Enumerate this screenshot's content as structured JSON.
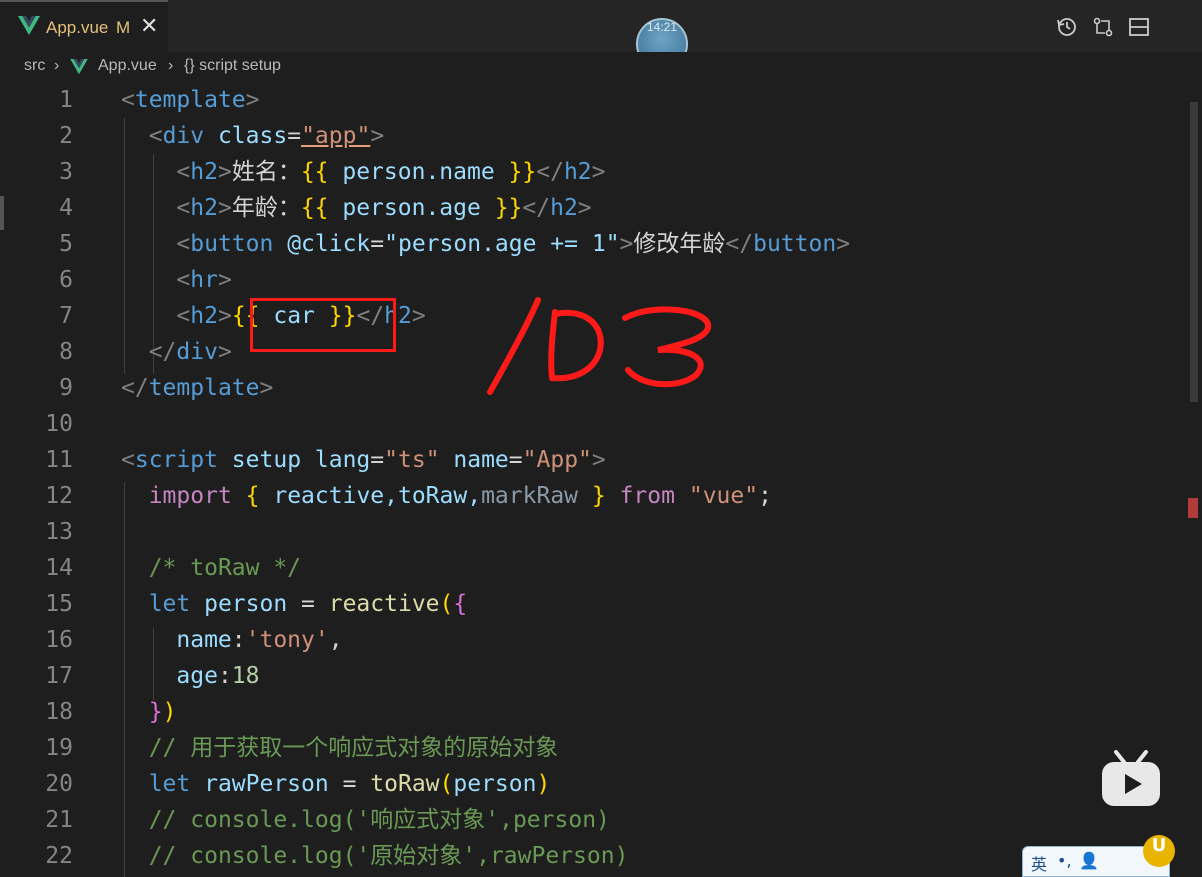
{
  "tab": {
    "label": "App.vue",
    "modified": "M",
    "close": "✕"
  },
  "clock": "14:21",
  "breadcrumb": {
    "root": "src",
    "file": "App.vue",
    "symbol": "{} script setup"
  },
  "lines": [
    {
      "n": "1"
    },
    {
      "n": "2"
    },
    {
      "n": "3"
    },
    {
      "n": "4"
    },
    {
      "n": "5"
    },
    {
      "n": "6"
    },
    {
      "n": "7"
    },
    {
      "n": "8"
    },
    {
      "n": "9"
    },
    {
      "n": "10"
    },
    {
      "n": "11"
    },
    {
      "n": "12"
    },
    {
      "n": "13"
    },
    {
      "n": "14"
    },
    {
      "n": "15"
    },
    {
      "n": "16"
    },
    {
      "n": "17"
    },
    {
      "n": "18"
    },
    {
      "n": "19"
    },
    {
      "n": "20"
    },
    {
      "n": "21"
    },
    {
      "n": "22"
    }
  ],
  "code": {
    "l1": [
      "<",
      "template",
      ">"
    ],
    "l2": [
      "<",
      "div",
      " class",
      "=",
      "\"app\"",
      ">"
    ],
    "l3": [
      "<",
      "h2",
      ">",
      "姓名：",
      "{{",
      " person.name ",
      "}}",
      "</",
      "h2",
      ">"
    ],
    "l4": [
      "<",
      "h2",
      ">",
      "年龄：",
      "{{",
      " person.age ",
      "}}",
      "</",
      "h2",
      ">"
    ],
    "l5": [
      "<",
      "button",
      " @click",
      "=",
      "\"person.age += 1\"",
      ">",
      "修改年龄",
      "</",
      "button",
      ">"
    ],
    "l6": [
      "<",
      "hr",
      ">"
    ],
    "l7": [
      "<",
      "h2",
      ">",
      "{{",
      " car ",
      "}}",
      "</",
      "h2",
      ">"
    ],
    "l8": [
      "</",
      "div",
      ">"
    ],
    "l9": [
      "</",
      "template",
      ">"
    ],
    "l11": [
      "<",
      "script",
      " setup",
      " lang",
      "=",
      "\"ts\"",
      " name",
      "=",
      "\"App\"",
      ">"
    ],
    "l12": [
      "import",
      " ",
      "{",
      " reactive,toRaw,",
      "markRaw",
      " ",
      "}",
      " from",
      " ",
      "\"vue\"",
      ";"
    ],
    "l14": "/* toRaw */",
    "l15": [
      "let",
      " person",
      " = ",
      "reactive",
      "(",
      "{"
    ],
    "l16": [
      "name",
      ":",
      "'tony'",
      ","
    ],
    "l17": [
      "age",
      ":",
      "18"
    ],
    "l18": [
      "}",
      ")"
    ],
    "l19": "// 用于获取一个响应式对象的原始对象",
    "l20": [
      "let",
      " rawPerson",
      " = ",
      "toRaw",
      "(",
      "person",
      ")"
    ],
    "l21": "// console.log('响应式对象',person)",
    "l22": "// console.log('原始对象',rawPerson)"
  },
  "annotation": "103",
  "ime": {
    "lang": "英",
    "punct": "•,",
    "user": "👤"
  },
  "colors": {
    "highlight": "#ff1a1a",
    "bg": "#1e1e1e"
  }
}
